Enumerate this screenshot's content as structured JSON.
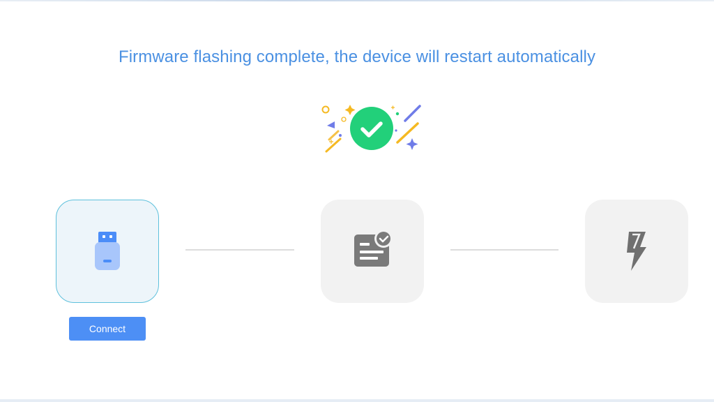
{
  "status": {
    "title": "Firmware flashing complete, the device will restart automatically",
    "illustration_icon": "success-check-confetti-icon",
    "accent_color": "#4a90e2",
    "success_color": "#22d07a"
  },
  "steps": [
    {
      "id": "connect",
      "icon": "usb-drive-icon",
      "state": "active",
      "button_label": "Connect"
    },
    {
      "id": "firmware",
      "icon": "firmware-document-check-icon",
      "state": "idle"
    },
    {
      "id": "flash",
      "icon": "lightning-bolt-icon",
      "state": "idle"
    }
  ],
  "colors": {
    "active_border": "#5ec0dc",
    "active_bg": "#edf5fa",
    "idle_bg": "#f2f2f2",
    "button": "#4d8ff5"
  }
}
